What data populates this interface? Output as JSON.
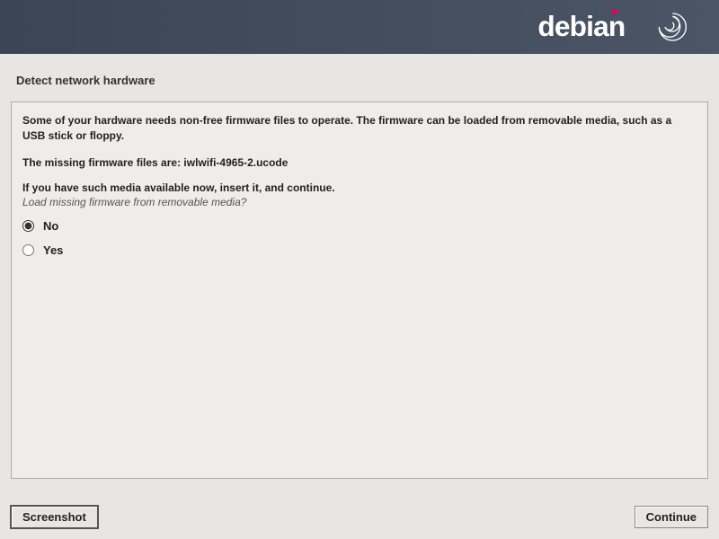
{
  "brand": "debian",
  "page_title": "Detect network hardware",
  "info_text": "Some of your hardware needs non-free firmware files to operate. The firmware can be loaded from removable media, such as a USB stick or floppy.",
  "missing_label": "The missing firmware files are: ",
  "missing_files": "iwlwifi-4965-2.ucode",
  "insert_text": "If you have such media available now, insert it, and continue.",
  "question": "Load missing firmware from removable media?",
  "options": {
    "no": "No",
    "yes": "Yes"
  },
  "selected": "no",
  "buttons": {
    "screenshot": "Screenshot",
    "continue": "Continue"
  }
}
